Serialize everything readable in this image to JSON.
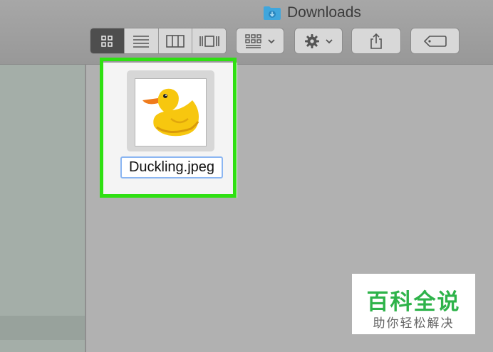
{
  "window": {
    "title": "Downloads"
  },
  "toolbar": {
    "view_buttons": [
      {
        "icon": "icon-view-icon",
        "active": true
      },
      {
        "icon": "list-view-icon",
        "active": false
      },
      {
        "icon": "column-view-icon",
        "active": false
      },
      {
        "icon": "coverflow-view-icon",
        "active": false
      }
    ],
    "arrange_icon": "arrange-grid-icon",
    "action_icon": "gear-icon",
    "share_icon": "share-icon",
    "tag_icon": "tag-icon"
  },
  "file": {
    "name": "Duckling.jpeg",
    "icon": "duck-image-icon"
  },
  "colors": {
    "highlight": "#2fe012",
    "selection": "#8bb6f2",
    "folder": "#3fa6dd",
    "watermark": "#2eb34a"
  },
  "watermark": {
    "main": "百科全说",
    "sub": "助你轻松解决"
  }
}
